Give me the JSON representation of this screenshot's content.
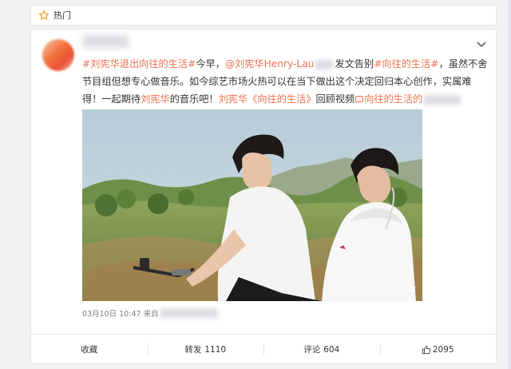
{
  "header_card": {
    "label": "热门",
    "icon": "star-outline-icon"
  },
  "post": {
    "text": {
      "tag1": "#刘宪华退出向往的生活#",
      "t1": "今早，",
      "mention": "@刘宪华Henry-Lau",
      "t2": "发文告别",
      "tag2": "#向往的生活#",
      "t3": "，虽然不舍节目组但想专心做音乐。如今综艺市场火热可以在当下做出这个决定回归本心创作，实属难得！一起期待",
      "name": "刘宪华",
      "t4": "的音乐吧！",
      "link_title": "刘宪华《向往的生活》",
      "t5": "回顾视频",
      "link2": "向往的生活的"
    },
    "timestamp": "03月10日 10:47 来自",
    "actions": {
      "favorite": "收藏",
      "repost_label": "转发",
      "repost_count": "1110",
      "comment_label": "评论",
      "comment_count": "604",
      "like_count": "2095"
    }
  },
  "colors": {
    "accent": "#eb7350",
    "page_bg": "#f2f2f5",
    "card_bg": "#ffffff",
    "meta_text": "#808080"
  }
}
